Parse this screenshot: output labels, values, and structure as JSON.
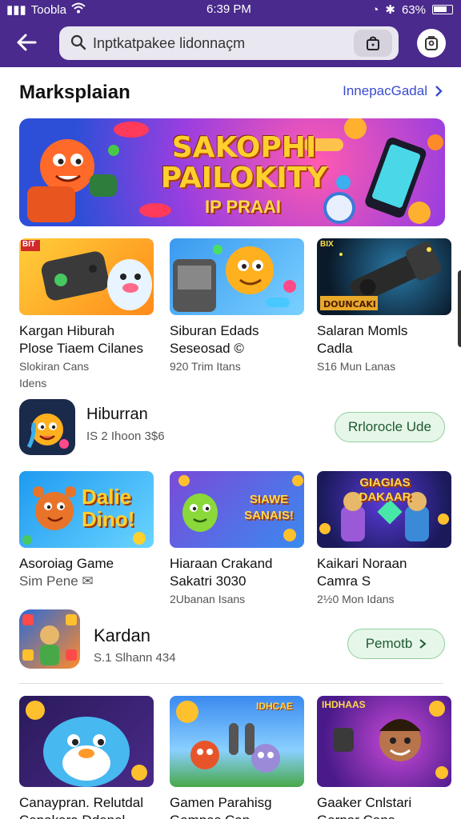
{
  "status": {
    "carrier": "Toobla",
    "time": "6:39 PM",
    "battery": "63%"
  },
  "search": {
    "query": "Inptkatpakee lidonnaçm"
  },
  "section": {
    "title": "Marksplaian",
    "see_all": "InnepacGadal"
  },
  "banner": {
    "title": "SAKOPHI PAILOKITY",
    "subtitle": "IP PRAAI"
  },
  "row1": [
    {
      "line1": "Kargan Hiburah",
      "line2": "Plose Tiaem Cilanes",
      "line3": "Slokiran Cans",
      "badge": "BIT"
    },
    {
      "line1": "Siburan Edads",
      "line2": "Seseosad ©",
      "line3": "920 Trim Itans"
    },
    {
      "line1": "Salaran Momls",
      "line2": "Cadla",
      "line3": "S16 Mun Lanas",
      "badge": "BIX"
    }
  ],
  "row1_extra": "Idens",
  "app1": {
    "name": "Hiburran",
    "meta": "IS 2 Ihoon 3$6",
    "button": "Rrlorocle Ude"
  },
  "row2": [
    {
      "line1": "Asoroiag Game",
      "line2": "Sim Pene ✉",
      "line3": "",
      "art": "Dalie Dino!"
    },
    {
      "line1": "Hiaraan Crakand",
      "line2": "Sakatri 3030",
      "line3": "2Ubanan Isans",
      "art": "SIAWE SANAIS!"
    },
    {
      "line1": "Kaikari Noraan",
      "line2": "Camra S",
      "line3": "2½0 Mon Idans",
      "art": "GIAGIAS DAKAAR"
    }
  ],
  "app2": {
    "name": "Kardan",
    "meta": "S.1 Slhann 434",
    "button": "Pemotb"
  },
  "row3": [
    {
      "line1": "Canaypran. Relutdal",
      "line2": "Cepakara Ddenel",
      "art": ""
    },
    {
      "line1": "Gamen Parahisg",
      "line2": "Gampas Can",
      "art": "IDHCAE"
    },
    {
      "line1": "Gaaker Cnlstari",
      "line2": "Garpar Cans",
      "art": "IHDHAAS"
    }
  ],
  "colors": {
    "appbar": "#4a2a8c",
    "accent": "#3a4bd0",
    "pill_border": "#8fd0a0",
    "pill_bg": "#e6f6e9"
  }
}
